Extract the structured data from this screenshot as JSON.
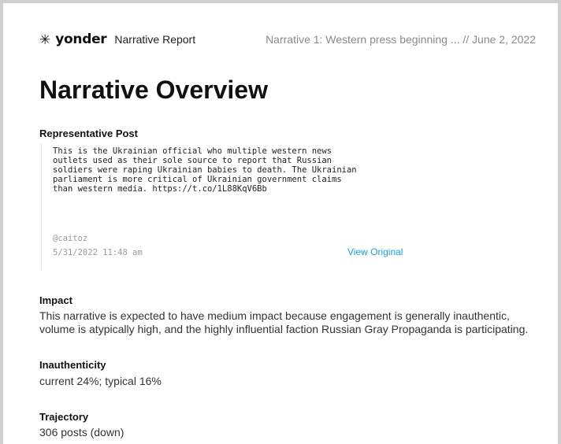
{
  "header": {
    "logo_mark": "✳",
    "logo_text": "yonder",
    "report_label": "Narrative Report",
    "right_text": "Narrative 1: Western press beginning ... // June 2, 2022"
  },
  "title": "Narrative Overview",
  "representative_post": {
    "label": "Representative Post",
    "text": "This is the Ukrainian official who multiple western news\noutlets used as their sole source to report that Russian\nsoldiers were raping Ukrainian babies to death. The Ukrainian\nparliament is more critical of Ukrainian government claims\nthan western media. https://t.co/1L88KqV6Bb",
    "author": "@caitoz",
    "timestamp": "5/31/2022 11:48 am",
    "link_label": "View Original"
  },
  "impact": {
    "label": "Impact",
    "text": "This narrative is expected to have medium impact because engagement is generally inauthentic, volume is atypically high, and the highly influential faction Russian Gray Propaganda is participating."
  },
  "inauthenticity": {
    "label": "Inauthenticity",
    "text": "current 24%; typical 16%"
  },
  "trajectory": {
    "label": "Trajectory",
    "text": "306 posts (down)"
  },
  "colors": {
    "link": "#1aa1dd",
    "muted": "#8a8a8a"
  }
}
